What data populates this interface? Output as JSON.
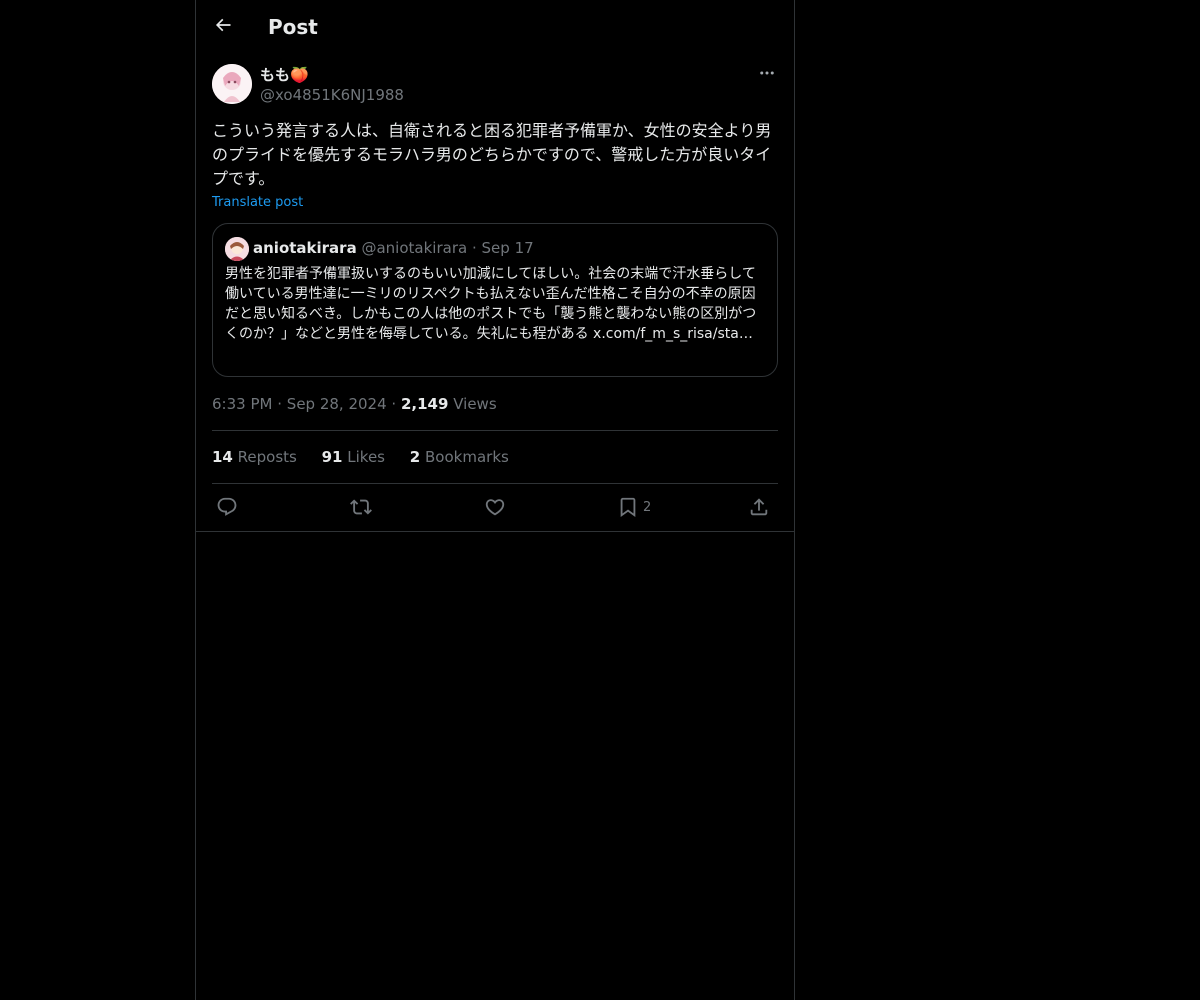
{
  "header": {
    "title": "Post",
    "back_icon": "arrow-left-icon"
  },
  "post": {
    "author": {
      "display_name": "もも🍑",
      "handle": "@xo4851K6NJ1988"
    },
    "text": "こういう発言する人は、自衛されると困る犯罪者予備軍か、女性の安全より男のプライドを優先するモラハラ男のどちらかですので、警戒した方が良いタイプです。",
    "translate_label": "Translate post",
    "quote": {
      "name": "aniotakirara",
      "handle": "@aniotakirara",
      "separator": "·",
      "date": "Sep 17",
      "text": "男性を犯罪者予備軍扱いするのもいい加減にしてほしい。社会の末端で汗水垂らして働いている男性達に一ミリのリスペクトも払えない歪んだ性格こそ自分の不幸の原因だと思い知るべき。しかもこの人は他のポストでも「襲う熊と襲わない熊の区別がつくのか？」などと男性を侮辱している。失礼にも程がある x.com/f_m_s_risa/sta…"
    },
    "time": "6:33 PM",
    "sep1": "·",
    "date": "Sep 28, 2024",
    "sep2": "·",
    "views_count": "2,149",
    "views_label": "Views",
    "stats": {
      "reposts_count": "14",
      "reposts_label": "Reposts",
      "likes_count": "91",
      "likes_label": "Likes",
      "bookmarks_count": "2",
      "bookmarks_label": "Bookmarks"
    },
    "actions": {
      "bookmark_count": "2"
    }
  },
  "colors": {
    "background": "#000000",
    "text": "#e7e9ea",
    "secondary": "#71767b",
    "link": "#1d9bf0",
    "border": "#2f3336"
  }
}
